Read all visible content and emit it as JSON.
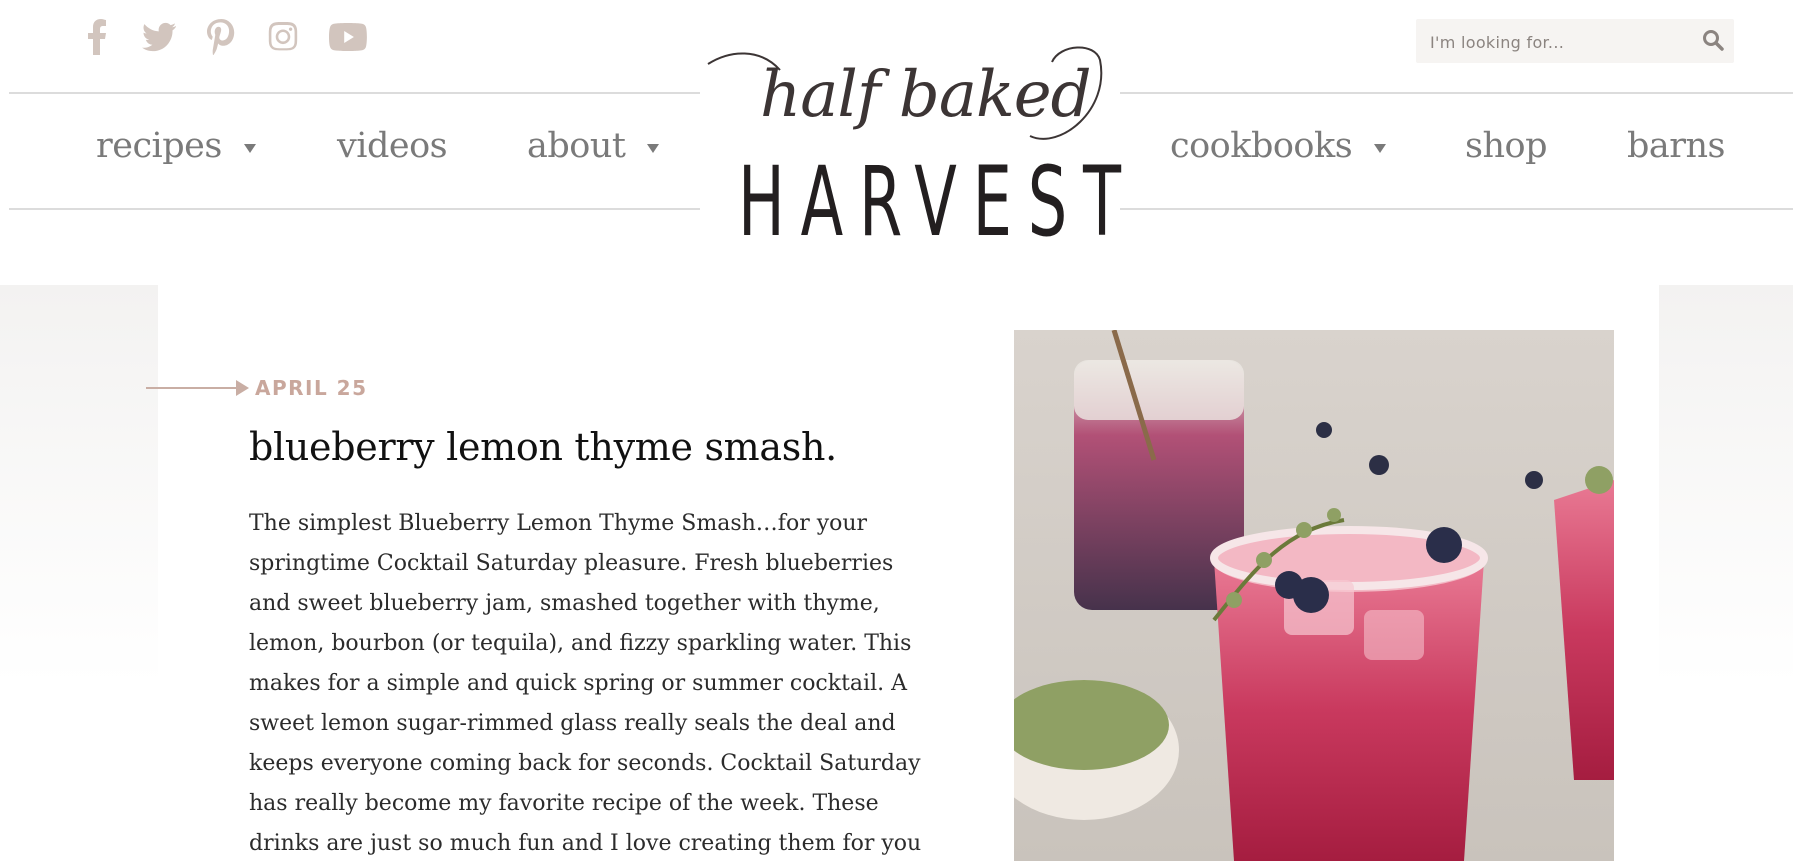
{
  "header": {
    "social_icons": [
      "facebook-icon",
      "twitter-icon",
      "pinterest-icon",
      "instagram-icon",
      "youtube-icon"
    ],
    "search": {
      "placeholder": "I'm looking for..."
    },
    "logo": {
      "script_text": "half baked",
      "main_text": "HARVEST"
    },
    "nav_left": [
      {
        "label": "recipes",
        "has_dropdown": true
      },
      {
        "label": "videos",
        "has_dropdown": false
      },
      {
        "label": "about",
        "has_dropdown": true
      }
    ],
    "nav_right": [
      {
        "label": "cookbooks",
        "has_dropdown": true
      },
      {
        "label": "shop",
        "has_dropdown": false
      },
      {
        "label": "barns",
        "has_dropdown": false
      }
    ]
  },
  "post": {
    "date": "APRIL 25",
    "title": "blueberry lemon thyme smash.",
    "body": "The simplest Blueberry Lemon Thyme Smash…for your springtime Cocktail Saturday pleasure. Fresh blueberries and sweet blueberry jam, smashed together with thyme, lemon, bourbon (or tequila), and fizzy sparkling water. This makes for a simple and quick spring or summer cocktail. A sweet lemon sugar-rimmed glass really seals the deal and keeps everyone coming back for seconds. Cocktail Saturday has really become my favorite recipe of the week. These drinks are just so much fun and I love creating them for you"
  },
  "colors": {
    "nav_text": "#7a7a7a",
    "social_icon": "#d2c5be",
    "date_accent": "#c9a79c",
    "logo_text": "#231f20"
  }
}
